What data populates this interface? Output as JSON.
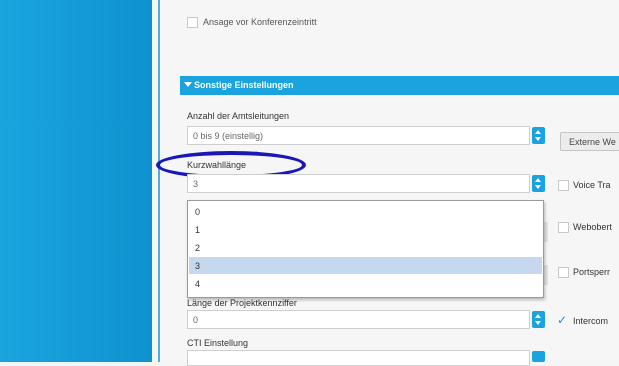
{
  "top_checkbox": {
    "label": "Ansage vor Konferenzeintritt"
  },
  "section": {
    "title": "Sonstige Einstellungen"
  },
  "trunk_lines": {
    "label": "Anzahl der Amtsleitungen",
    "value": "0 bis 9 (einstellig)",
    "button": "Externe We"
  },
  "speed_dial": {
    "label": "Kurzwahllänge",
    "value": "3",
    "options": [
      "0",
      "1",
      "2",
      "3",
      "4"
    ],
    "selected": "3"
  },
  "right_options": [
    {
      "label": "Voice Tra",
      "checked": false
    },
    {
      "label": "Webobert",
      "checked": false
    },
    {
      "label": "Portsperr",
      "checked": false
    },
    {
      "label": "Intercom",
      "checked": true
    }
  ],
  "project_code": {
    "label": "Länge der Projektkennziffer",
    "value": "0"
  },
  "cti": {
    "label": "CTI Einstellung"
  },
  "colors": {
    "accent": "#1ba3e0",
    "sidebar": "#1aa5df",
    "highlight_ring": "#1a16b8",
    "selected_row": "#c5d8ee"
  }
}
